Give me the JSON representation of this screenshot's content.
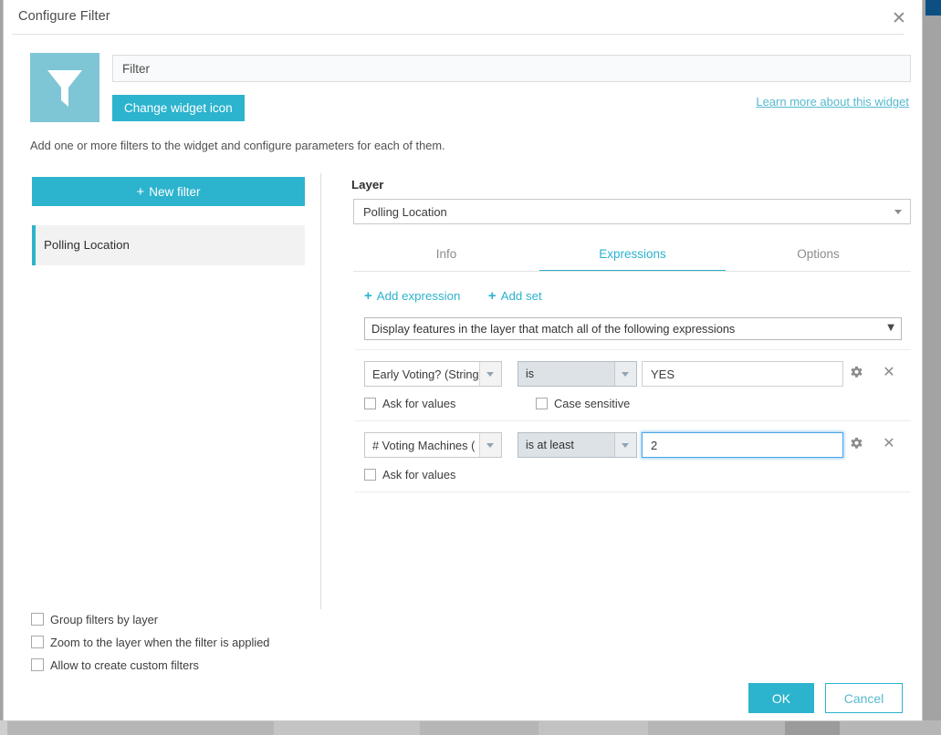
{
  "dialog": {
    "title": "Configure Filter",
    "close_label": "✕"
  },
  "widget": {
    "icon_name": "funnel-icon",
    "name_value": "Filter",
    "name_placeholder": "Filter",
    "change_icon_label": "Change widget icon",
    "learn_more_label": "Learn more about this widget",
    "hint": "Add one or more filters to the widget and configure parameters for each of them."
  },
  "sidebar": {
    "new_filter_label": "New filter",
    "new_filter_plus": "+",
    "filters": [
      {
        "label": "Polling Location",
        "selected": true
      }
    ]
  },
  "main": {
    "layer_label": "Layer",
    "layer_value": "Polling Location",
    "tabs": [
      {
        "label": "Info",
        "active": false
      },
      {
        "label": "Expressions",
        "active": true
      },
      {
        "label": "Options",
        "active": false
      }
    ],
    "add_expression_label": "Add expression",
    "add_set_label": "Add set",
    "add_plus": "+",
    "match_value": "Display features in the layer that match all of the following expressions",
    "match_caret": "▼",
    "expressions": [
      {
        "field": "Early Voting? (String",
        "operator": "is",
        "value": "YES",
        "focused": false,
        "options": [
          {
            "label": "Ask for values",
            "checked": false
          },
          {
            "label": "Case sensitive",
            "checked": false
          }
        ]
      },
      {
        "field": "# Voting Machines (",
        "operator": "is at least",
        "value": "2",
        "focused": true,
        "options": [
          {
            "label": "Ask for values",
            "checked": false
          }
        ]
      }
    ],
    "settings_icon_name": "gear-icon",
    "remove_icon_name": "close-icon",
    "remove_label": "✕"
  },
  "bottom_options": [
    {
      "label": "Group filters by layer",
      "checked": false
    },
    {
      "label": "Zoom to the layer when the filter is applied",
      "checked": false
    },
    {
      "label": "Allow to create custom filters",
      "checked": false
    }
  ],
  "footer": {
    "ok_label": "OK",
    "cancel_label": "Cancel"
  },
  "colors": {
    "accent": "#2cb3ce",
    "link": "#56b9d0",
    "icon_tile": "#7ec6d5",
    "focus_ring": "#4aa8e8",
    "navy": "#0b4f83"
  }
}
